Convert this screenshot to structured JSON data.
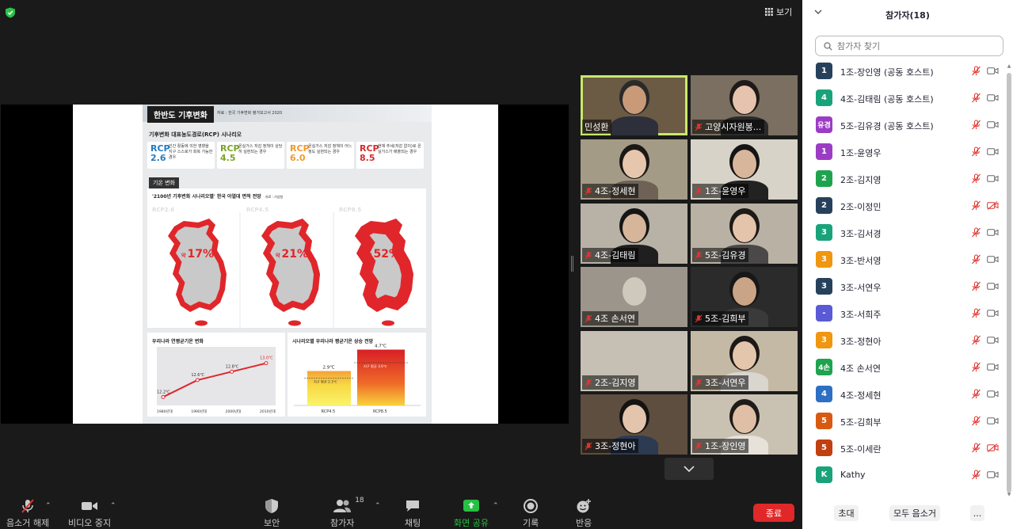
{
  "view_label": "보기",
  "slide": {
    "title": "한반도 기후변화",
    "source": "자료 : 한국 기후변화 평가보고서 2020",
    "subtitle": "기후변화 대표농도경로(RCP) 시나리오",
    "rcp_cards": [
      {
        "code": "RCP 2.6",
        "color": "#1f7bc1",
        "desc": "인간 활동에 의한 영향을 지구 스스로가 회복 가능한 경우"
      },
      {
        "code": "RCP 4.5",
        "color": "#7aa22a",
        "desc": "온실가스 저감 정책이 상당히 실현되는 경우"
      },
      {
        "code": "RCP 6.0",
        "color": "#ef9a2a",
        "desc": "온실가스 저감 정책이 어느 정도 실현되는 경우"
      },
      {
        "code": "RCP 8.5",
        "color": "#d62a2a",
        "desc": "현재 추세(저감 없이)로 온실가스가 배출되는 경우"
      }
    ],
    "temp_tag": "기온 변화",
    "map_caption": "'2100년 기후변화 시나리오별' 한국 아열대 면적 전망",
    "map_caption_src": "자료 : 기상청",
    "maps": [
      {
        "label": "RCP2.6",
        "color": "#1f7bc1",
        "prefix": "약",
        "pct": "17%",
        "fill": 0.17
      },
      {
        "label": "RCP4.5",
        "color": "#7aa22a",
        "prefix": "약",
        "pct": "21%",
        "fill": 0.21
      },
      {
        "label": "RCP8.5",
        "color": "#d62a2a",
        "prefix": "약",
        "pct": "52%",
        "fill": 0.52
      }
    ],
    "line_panel": {
      "title": "우리나라 연평균기온 변화",
      "points": [
        {
          "x": "1980년대",
          "y": 12.2,
          "label": "12.2℃"
        },
        {
          "x": "1990년대",
          "y": 12.6,
          "label": "12.6℃"
        },
        {
          "x": "2000년대",
          "y": 12.8,
          "label": "12.8℃"
        },
        {
          "x": "2010년대",
          "y": 13.0,
          "label": "13.0℃"
        }
      ]
    },
    "bar_panel": {
      "title": "시나리오별 우리나라 평균기온 상승 전망",
      "bars": [
        {
          "name": "RCP4.5",
          "value": 2.9,
          "label": "2.9℃"
        },
        {
          "name": "RCP8.5",
          "value": 4.7,
          "label": "4.7℃"
        }
      ],
      "ref_label_low": "지구 평균 2.3℃",
      "ref_label_high": "지구 평균 3.6℃"
    }
  },
  "tiles": [
    {
      "name": "민성환",
      "muted": false,
      "speaking": true,
      "bg": "#6b5a44",
      "skin": "#c99a78",
      "hair": "#2a2a2a",
      "shirt": "#2d2f3a"
    },
    {
      "name": "고양시자원봉...",
      "muted": true,
      "speaking": false,
      "bg": "#7a6f60",
      "skin": "#e5c3ad",
      "hair": "#1f1a18",
      "shirt": "#2a2a2a"
    },
    {
      "name": "4조-정세현",
      "muted": true,
      "speaking": false,
      "bg": "#a49b86",
      "skin": "#e6c6ad",
      "hair": "#1c1816",
      "shirt": "#6e6256"
    },
    {
      "name": "1조-윤영우",
      "muted": true,
      "speaking": false,
      "bg": "#d8d3c8",
      "skin": "#d8b69c",
      "hair": "#141414",
      "shirt": "#222"
    },
    {
      "name": "4조-김태림",
      "muted": true,
      "speaking": false,
      "bg": "#b8b1a6",
      "skin": "#d7b59a",
      "hair": "#161616",
      "shirt": "#1f1f1f"
    },
    {
      "name": "5조-김유경",
      "muted": true,
      "speaking": false,
      "bg": "#b9b1a4",
      "skin": "#e4c4ab",
      "hair": "#1d1a18",
      "shirt": "#4a4848"
    },
    {
      "name": "4조 손서연",
      "muted": true,
      "speaking": false,
      "bg": "#9b958b",
      "skin": "#cfc8bd",
      "hair": "#9b958b",
      "shirt": "#9b958b"
    },
    {
      "name": "5조-김희부",
      "muted": true,
      "speaking": false,
      "bg": "#2b2b2b",
      "skin": "#c9a486",
      "hair": "#171717",
      "shirt": "#3a3a3a"
    },
    {
      "name": "2조-김지영",
      "muted": true,
      "speaking": false,
      "bg": "#c6c0b4",
      "skin": "#c6c0b4",
      "hair": "#c6c0b4",
      "shirt": "#c6c0b4"
    },
    {
      "name": "3조-서연우",
      "muted": true,
      "speaking": false,
      "bg": "#c4b9a4",
      "skin": "#e4c6ad",
      "hair": "#1c1917",
      "shirt": "#d9d6d0"
    },
    {
      "name": "3조-정현아",
      "muted": true,
      "speaking": false,
      "bg": "#5e4e40",
      "skin": "#e3c4ac",
      "hair": "#151312",
      "shirt": "#2c3a52"
    },
    {
      "name": "1조-장인영",
      "muted": true,
      "speaking": false,
      "bg": "#c9c2b3",
      "skin": "#dfbfa5",
      "hair": "#1f1b18",
      "shirt": "#e6e2da"
    }
  ],
  "toolbar": {
    "mute": "음소거 해제",
    "video": "비디오 중지",
    "security": "보안",
    "participants": "참가자",
    "participants_count": "18",
    "chat": "채팅",
    "share": "화면 공유",
    "record": "기록",
    "reactions": "반응",
    "end": "종료"
  },
  "panel": {
    "title": "참가자(18)",
    "search_placeholder": "참가자 찾기",
    "participants": [
      {
        "avatar": "1",
        "color": "#27415c",
        "name": "1조-장인영 (공동 호스트)",
        "cam_off": false
      },
      {
        "avatar": "4",
        "color": "#1aa37a",
        "name": "4조-김태림 (공동 호스트)",
        "cam_off": false
      },
      {
        "avatar": "유경",
        "color": "#9c3cc4",
        "name": "5조-김유경 (공동 호스트)",
        "cam_off": false
      },
      {
        "avatar": "1",
        "color": "#9c3cc4",
        "name": "1조-윤영우",
        "cam_off": false
      },
      {
        "avatar": "2",
        "color": "#1fa34e",
        "name": "2조-김지영",
        "cam_off": false
      },
      {
        "avatar": "2",
        "color": "#27415c",
        "name": "2조-이정민",
        "cam_off": true
      },
      {
        "avatar": "3",
        "color": "#1aa37a",
        "name": "3조-김서경",
        "cam_off": false
      },
      {
        "avatar": "3",
        "color": "#f0960f",
        "name": "3조-반서영",
        "cam_off": false
      },
      {
        "avatar": "3",
        "color": "#27415c",
        "name": "3조-서연우",
        "cam_off": false
      },
      {
        "avatar": "-",
        "color": "#5a5ad6",
        "name": "3조-서희주",
        "cam_off": false
      },
      {
        "avatar": "3",
        "color": "#f0960f",
        "name": "3조-정현아",
        "cam_off": false
      },
      {
        "avatar": "4손",
        "color": "#1fa34e",
        "name": "4조 손서연",
        "cam_off": false
      },
      {
        "avatar": "4",
        "color": "#2d6fc4",
        "name": "4조-정세현",
        "cam_off": false
      },
      {
        "avatar": "5",
        "color": "#d85a12",
        "name": "5조-김희부",
        "cam_off": false
      },
      {
        "avatar": "5",
        "color": "#c23f10",
        "name": "5조-이세란",
        "cam_off": true
      },
      {
        "avatar": "K",
        "color": "#1aa37a",
        "name": "Kathy",
        "cam_off": false
      }
    ],
    "invite": "초대",
    "mute_all": "모두 음소거",
    "more": "..."
  }
}
